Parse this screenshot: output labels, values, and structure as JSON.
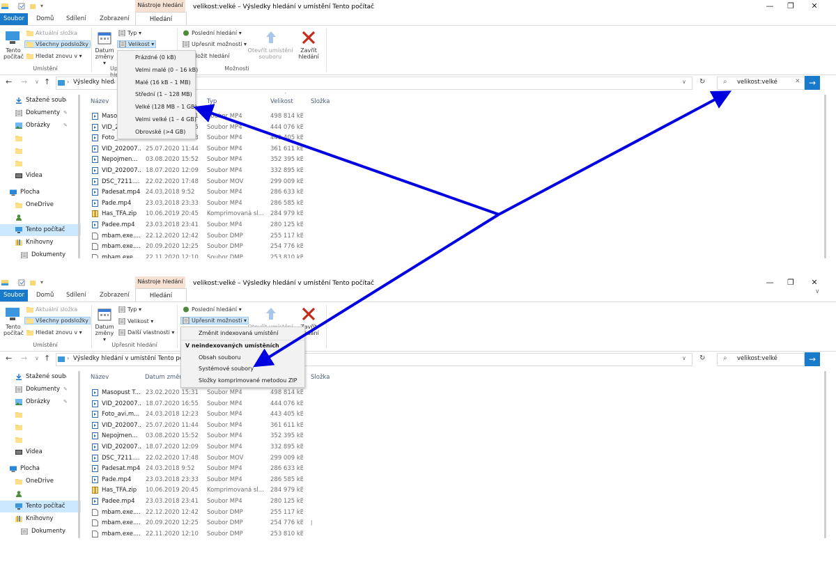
{
  "colors": {
    "accent": "#1979ca",
    "arrow": "#0000e0",
    "context_tab": "#f7e1d2",
    "close_red": "#c42b1c"
  },
  "window": {
    "title": "velikost:velké – Výsledky hledání v umístění Tento počítač",
    "context_tab_title": "Nástroje hledání",
    "controls": {
      "minimize": "—",
      "maximize": "❐",
      "close": "✕"
    }
  },
  "tabs": {
    "file": "Soubor",
    "home": "Domů",
    "share": "Sdílení",
    "view": "Zobrazení",
    "search": "Hledání"
  },
  "ribbon": {
    "this_pc": "Tento počítač",
    "current_folder": "Aktuální složka",
    "all_subfolders": "Všechny podsložky",
    "search_again": "Hledat znovu v ▾",
    "location_group": "Umístění",
    "date_modified": "Datum změny ▾",
    "type": "Typ ▾",
    "size": "Velikost ▾",
    "other_props": "Další vlastnosti ▾",
    "refine_group": "Upřesnit hledání",
    "recent_searches": "Poslední hledání ▾",
    "advanced_options": "Upřesnit možnosti ▾",
    "save_search": "Uložit hledání",
    "open_location": "Otevřít umístění souboru",
    "options_group": "Možnosti",
    "close_search": "Zavřít hledání"
  },
  "address": {
    "path": "Výsledky hledání v umístění Tento počítač",
    "search_query": "velikost:velké"
  },
  "nav": [
    {
      "label": "Stažené soub",
      "icon": "download-icon",
      "pin": true
    },
    {
      "label": "Dokumenty",
      "icon": "documents-icon",
      "pin": true
    },
    {
      "label": "Obrázky",
      "icon": "pictures-icon",
      "pin": true
    },
    {
      "label": "",
      "icon": "folder-icon"
    },
    {
      "label": "",
      "icon": "folder-icon"
    },
    {
      "label": "",
      "icon": "folder-icon"
    },
    {
      "label": "Videa",
      "icon": "videos-icon"
    },
    {
      "label": "Plocha",
      "icon": "desktop-icon"
    },
    {
      "label": "OneDrive",
      "icon": "folder-icon"
    },
    {
      "label": "",
      "icon": "user-icon"
    },
    {
      "label": "Tento počítač",
      "icon": "computer-icon",
      "selected": true
    },
    {
      "label": "Knihovny",
      "icon": "libraries-icon"
    },
    {
      "label": "Dokumenty",
      "icon": "documents-icon"
    }
  ],
  "columns": {
    "name": "Název",
    "date": "Datum změny",
    "type": "Typ",
    "size": "Velikost",
    "folder": "Složka"
  },
  "files": [
    {
      "name": "Masopust T...",
      "date": "23.02.2020 15:31",
      "type": "Soubor MP4",
      "size": "498 814 kB",
      "icon": "video-file-icon"
    },
    {
      "name": "VID_202007...",
      "date": "18.07.2020 16:55",
      "type": "Soubor MP4",
      "size": "444 076 kB",
      "icon": "video-file-icon"
    },
    {
      "name": "Foto_avi.m...",
      "date": "24.03.2018 12:23",
      "type": "Soubor MP4",
      "size": "443 405 kB",
      "icon": "video-file-icon"
    },
    {
      "name": "VID_202007...",
      "date": "25.07.2020 11:44",
      "type": "Soubor MP4",
      "size": "361 611 kB",
      "icon": "video-file-icon"
    },
    {
      "name": "Nepojmen...",
      "date": "03.08.2020 15:52",
      "type": "Soubor MP4",
      "size": "352 395 kB",
      "icon": "video-file-icon"
    },
    {
      "name": "VID_202007...",
      "date": "18.07.2020 12:09",
      "type": "Soubor MP4",
      "size": "332 895 kB",
      "icon": "video-file-icon"
    },
    {
      "name": "DSC_7211....",
      "date": "22.02.2020 17:48",
      "type": "Soubor MOV",
      "size": "299 009 kB",
      "icon": "video-file-icon"
    },
    {
      "name": "Padesat.mp4",
      "date": "24.03.2018 9:52",
      "type": "Soubor MP4",
      "size": "286 633 kB",
      "icon": "video-file-icon"
    },
    {
      "name": "Pade.mp4",
      "date": "23.03.2018 23:33",
      "type": "Soubor MP4",
      "size": "286 585 kB",
      "icon": "video-file-icon"
    },
    {
      "name": "Has_TFA.zip",
      "date": "10.06.2019 20:45",
      "type": "Komprimovaná sl...",
      "size": "284 979 kB",
      "icon": "zip-file-icon"
    },
    {
      "name": "Padee.mp4",
      "date": "23.03.2018 23:41",
      "type": "Soubor MP4",
      "size": "280 125 kB",
      "icon": "video-file-icon"
    },
    {
      "name": "mbam.exe....",
      "date": "22.12.2020 12:42",
      "type": "Soubor DMP",
      "size": "255 117 kB",
      "icon": "file-icon"
    },
    {
      "name": "mbam.exe....",
      "date": "20.09.2020 12:25",
      "type": "Soubor DMP",
      "size": "254 776 kB",
      "icon": "file-icon"
    },
    {
      "name": "mbam.exe....",
      "date": "22.11.2020 12:10",
      "type": "Soubor DMP",
      "size": "253 810 kB",
      "icon": "file-icon"
    }
  ],
  "size_menu": [
    "Prázdné (0 kB)",
    "Velmi malé (0 – 16 kB)",
    "Malé (16 kB – 1 MB)",
    "Střední (1 – 128 MB)",
    "Velké (128 MB – 1 GB)",
    "Velmi velké (1 – 4 GB)",
    "Obrovské (>4 GB)"
  ],
  "options_menu": {
    "change_indexed": "Změnit indexovaná umístění",
    "non_indexed_header": "V neindexovaných umístěních",
    "file_contents": "Obsah souboru",
    "system_files": "Systémové soubory",
    "zip_folders": "Složky komprimované metodou ZIP"
  }
}
